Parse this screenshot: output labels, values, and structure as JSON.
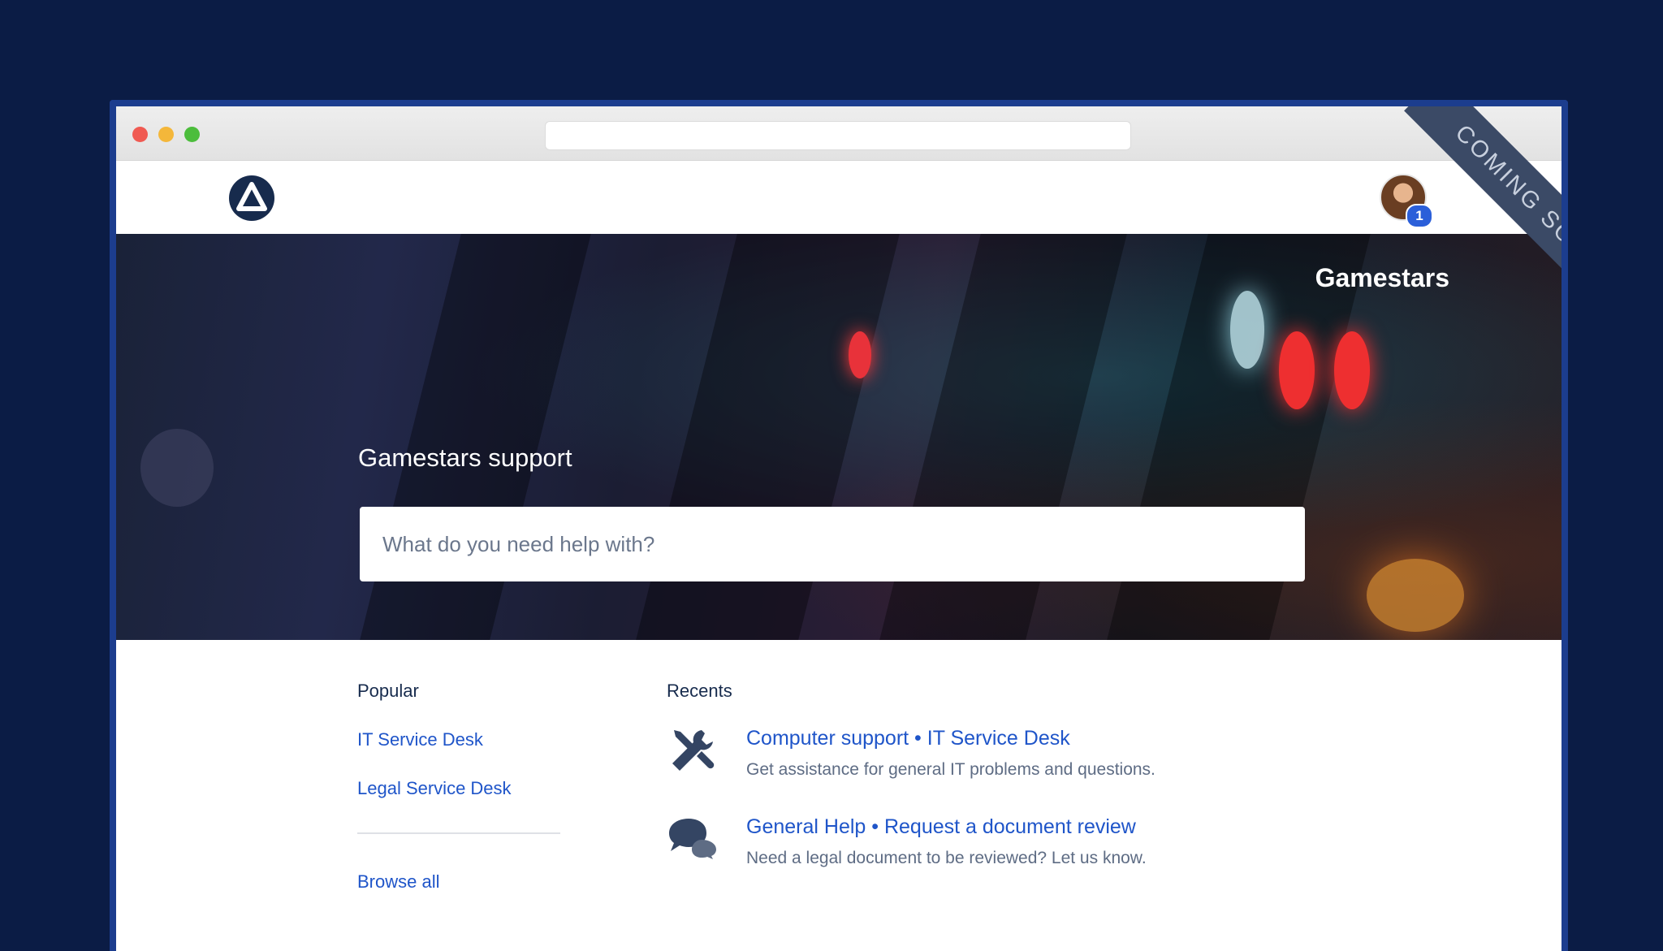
{
  "ribbon": {
    "text": "COMING SOON"
  },
  "header": {
    "notification_count": "1"
  },
  "hero": {
    "brand": "Gamestars",
    "title": "Gamestars support",
    "search_placeholder": "What do you need help with?"
  },
  "popular": {
    "heading": "Popular",
    "items": [
      {
        "label": "IT Service Desk"
      },
      {
        "label": "Legal Service Desk"
      }
    ],
    "browse_all": "Browse all"
  },
  "recents": {
    "heading": "Recents",
    "items": [
      {
        "project": "Computer support",
        "desk": "IT Service Desk",
        "description": "Get assistance for general IT problems and questions.",
        "icon": "wrench-screwdriver-icon"
      },
      {
        "project": "General Help",
        "desk": "Request a document review",
        "description": "Need a legal document to be reviewed? Let us know.",
        "icon": "chat-bubbles-icon"
      }
    ]
  },
  "colors": {
    "page_background": "#0b1c45",
    "window_border": "#1c3d8e",
    "link": "#1f55c9",
    "text_dark": "#172b4d",
    "badge": "#2b5fd9"
  }
}
